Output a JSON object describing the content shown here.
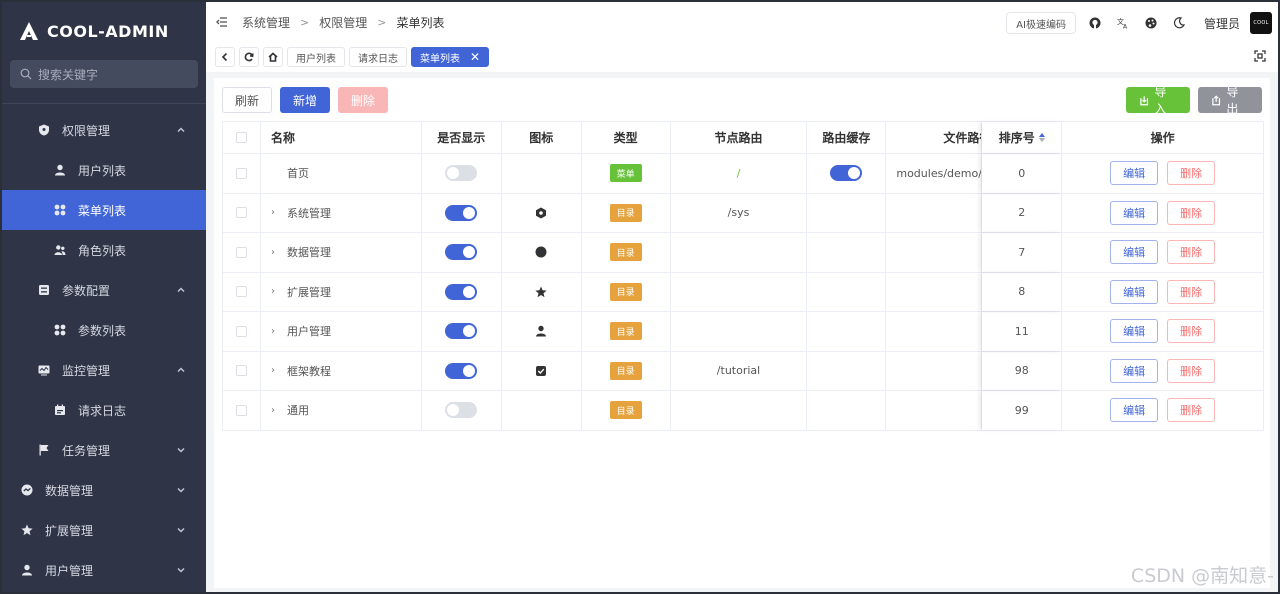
{
  "app": {
    "name": "COOL-ADMIN"
  },
  "sidebar": {
    "search_placeholder": "搜索关键字",
    "items": [
      {
        "label": "权限管理",
        "level": 1,
        "icon": "shield-icon",
        "expanded": true
      },
      {
        "label": "用户列表",
        "level": 2,
        "icon": "user-icon"
      },
      {
        "label": "菜单列表",
        "level": 2,
        "icon": "grid-icon",
        "active": true
      },
      {
        "label": "角色列表",
        "level": 2,
        "icon": "users-icon"
      },
      {
        "label": "参数配置",
        "level": 1,
        "icon": "config-icon",
        "expanded": true
      },
      {
        "label": "参数列表",
        "level": 2,
        "icon": "grid-icon"
      },
      {
        "label": "监控管理",
        "level": 1,
        "icon": "monitor-icon",
        "expanded": true
      },
      {
        "label": "请求日志",
        "level": 2,
        "icon": "log-icon"
      },
      {
        "label": "任务管理",
        "level": 1,
        "icon": "flag-icon",
        "expanded": false
      },
      {
        "label": "数据管理",
        "level": 0,
        "icon": "data-icon",
        "expanded": false
      },
      {
        "label": "扩展管理",
        "level": 0,
        "icon": "star-icon",
        "expanded": false
      },
      {
        "label": "用户管理",
        "level": 0,
        "icon": "user-icon",
        "expanded": false
      }
    ]
  },
  "topbar": {
    "breadcrumb": [
      "系统管理",
      "权限管理",
      "菜单列表"
    ],
    "ai_button": "AI极速编码",
    "user_name": "管理员",
    "avatar_text": "COOL"
  },
  "tabs": [
    {
      "label": "用户列表"
    },
    {
      "label": "请求日志"
    },
    {
      "label": "菜单列表",
      "active": true
    }
  ],
  "toolbar": {
    "refresh": "刷新",
    "add": "新增",
    "delete": "删除",
    "import": "导入",
    "export": "导出"
  },
  "table": {
    "headers": {
      "name": "名称",
      "show": "是否显示",
      "icon": "图标",
      "type": "类型",
      "path": "节点路由",
      "cache": "路由缓存",
      "file": "文件路径",
      "sort": "排序号",
      "op": "操作"
    },
    "edit_label": "编辑",
    "delete_label": "删除",
    "rows": [
      {
        "name": "首页",
        "expandable": false,
        "show": false,
        "icon": "",
        "type": "菜单",
        "type_kind": "menu",
        "path": "/",
        "cache": true,
        "file": "modules/demo/vi",
        "sort": "0"
      },
      {
        "name": "系统管理",
        "expandable": true,
        "show": true,
        "icon": "hexagon-icon",
        "type": "目录",
        "type_kind": "dir",
        "path": "/sys",
        "cache": null,
        "file": "",
        "sort": "2"
      },
      {
        "name": "数据管理",
        "expandable": true,
        "show": true,
        "icon": "data-icon",
        "type": "目录",
        "type_kind": "dir",
        "path": "",
        "cache": null,
        "file": "",
        "sort": "7"
      },
      {
        "name": "扩展管理",
        "expandable": true,
        "show": true,
        "icon": "star-icon",
        "type": "目录",
        "type_kind": "dir",
        "path": "",
        "cache": null,
        "file": "",
        "sort": "8"
      },
      {
        "name": "用户管理",
        "expandable": true,
        "show": true,
        "icon": "user-icon",
        "type": "目录",
        "type_kind": "dir",
        "path": "",
        "cache": null,
        "file": "",
        "sort": "11"
      },
      {
        "name": "框架教程",
        "expandable": true,
        "show": true,
        "icon": "check-square-icon",
        "type": "目录",
        "type_kind": "dir",
        "path": "/tutorial",
        "cache": null,
        "file": "",
        "sort": "98"
      },
      {
        "name": "通用",
        "expandable": true,
        "show": false,
        "icon": "",
        "type": "目录",
        "type_kind": "dir",
        "path": "",
        "cache": null,
        "file": "",
        "sort": "99"
      }
    ]
  },
  "watermark": "CSDN @南知意-"
}
